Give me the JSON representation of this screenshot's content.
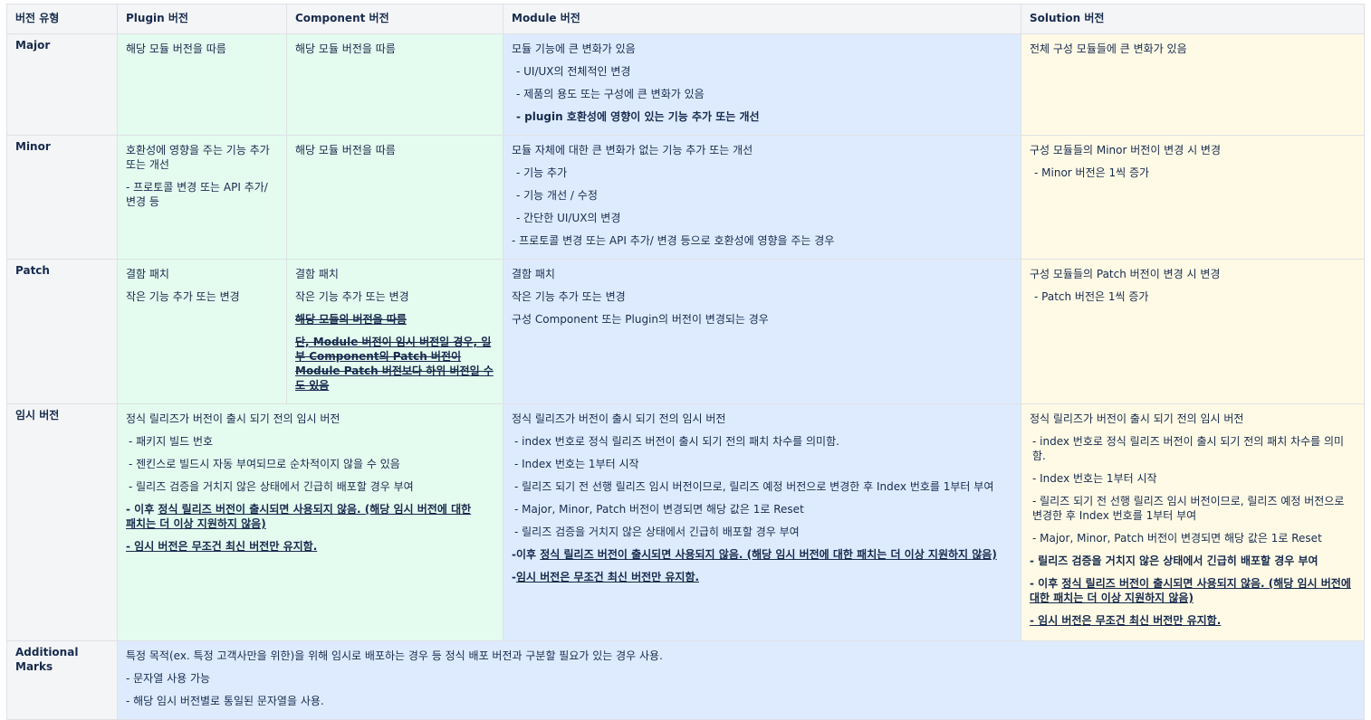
{
  "headers": {
    "type": "버전 유형",
    "plugin": "Plugin 버전",
    "component": "Component 버전",
    "module": "Module 버전",
    "solution": "Solution 버전"
  },
  "major": {
    "label": "Major",
    "plugin": [
      "해당 모듈 버전을 따름"
    ],
    "component": [
      "해당 모듈 버전을 따름"
    ],
    "module": [
      "모듈 기능에 큰 변화가 있음",
      "- UI/UX의 전체적인 변경",
      "- 제품의 용도 또는 구성에 큰 변화가 있음",
      "- plugin 호환성에 영향이 있는 기능 추가 또는 개선"
    ],
    "solution": [
      "전체 구성 모듈들에 큰 변화가 있음"
    ]
  },
  "minor": {
    "label": "Minor",
    "plugin": [
      "호환성에 영향을 주는 기능 추가 또는 개선",
      "- 프로토콜 변경 또는 API 추가/ 변경 등"
    ],
    "component": [
      "해당 모듈 버전을 따름"
    ],
    "module": [
      "모듈 자체에 대한 큰 변화가 없는 기능 추가 또는 개선",
      "- 기능 추가",
      "- 기능 개선 / 수정",
      "- 간단한 UI/UX의 변경",
      "-  프로토콜 변경 또는 API 추가/ 변경 등으로 호환성에 영향을 주는 경우"
    ],
    "solution": [
      "구성 모듈들의 Minor 버전이 변경 시 변경",
      "- Minor 버전은 1씩 증가"
    ]
  },
  "patch": {
    "label": "Patch",
    "plugin": [
      "결함 패치",
      "작은 기능 추가 또는 변경"
    ],
    "component": [
      "결함 패치",
      "작은 기능 추가 또는 변경"
    ],
    "component_strike": [
      "해당 모듈의 버전을 따름",
      "단, Module 버전이 임시 버전일 경우, 일부 Component의 Patch 버전이 Module Patch 버전보다 하위 버전일 수도 있음"
    ],
    "module": [
      "결함 패치",
      "작은 기능 추가 또는 변경",
      "구성 Component 또는 Plugin의 버전이 변경되는 경우"
    ],
    "solution": [
      "구성 모듈들의 Patch 버전이 변경 시 변경",
      "- Patch 버전은 1씩 증가"
    ]
  },
  "temp": {
    "label": "임시 버전",
    "plugin": [
      "정식 릴리즈가 버전이 출시 되기 전의 임시 버전",
      "- 패키지 빌드 번호",
      "- 젠킨스로 빌드시 자동 부여되므로 순차적이지 않을 수 있음",
      "- 릴리즈 검증을 거치지 않은 상태에서 긴급히 배포할 경우 부여"
    ],
    "plugin_emph_prefix": "- 이후 ",
    "plugin_emph": "정식 릴리즈 버전이 출시되면 사용되지 않음. (해당 임시 버전에 대한 패치는 더 이상 지원하지 않음)",
    "plugin_last": "- 임시 버전은 무조건 최신 버전만 유지함.",
    "module": [
      "정식 릴리즈가 버전이 출시 되기 전의 임시 버전",
      "- index 번호로 정식 릴리즈 버전이 출시 되기 전의 패치 차수를 의미함.",
      "- Index 번호는 1부터 시작",
      "- 릴리즈 되기 전 선행 릴리즈 임시 버전이므로, 릴리즈 예정 버전으로 변경한 후 Index 번호를 1부터 부여",
      "- Major, Minor, Patch 버전이 변경되면 해당 값은 1로 Reset",
      "- 릴리즈 검증을 거치지 않은 상태에서 긴급히 배포할 경우 부여"
    ],
    "module_emph_prefix": "-이후 ",
    "module_emph": "정식 릴리즈 버전이 출시되면 사용되지 않음. (해당 임시 버전에 대한 패치는 더 이상 지원하지 않음)",
    "module_last_prefix": "-",
    "module_last": "임시 버전은 무조건 최신 버전만 유지함.",
    "solution": [
      "정식 릴리즈가 버전이 출시 되기 전의 임시 버전",
      "- index 번호로 정식 릴리즈 버전이 출시 되기 전의 패치 차수를 의미함.",
      "- Index 번호는 1부터 시작",
      "- 릴리즈 되기 전 선행 릴리즈 임시 버전이므로, 릴리즈 예정 버전으로 변경한 후 Index 번호를 1부터 부여",
      "- Major, Minor, Patch 버전이 변경되면 해당 값은 1로 Reset"
    ],
    "solution_bold": "- 릴리즈 검증을 거치지 않은 상태에서 긴급히 배포할 경우 부여",
    "solution_emph_prefix": "- 이후 ",
    "solution_emph": "정식 릴리즈 버전이 출시되면 사용되지 않음. (해당 임시 버전에 대한 패치는 더 이상 지원하지 않음)",
    "solution_last": "- 임시 버전은 무조건 최신 버전만 유지함."
  },
  "additional": {
    "label": "Additional Marks",
    "lines": [
      "특정 목적(ex. 특정 고객사만을 위한)을 위해 임시로 배포하는 경우 등 정식 배포 버전과 구분할 필요가 있는 경우 사용.",
      "- 문자열 사용 가능",
      "- 해당 임시 버전별로 통일된 문자열을 사용."
    ]
  }
}
